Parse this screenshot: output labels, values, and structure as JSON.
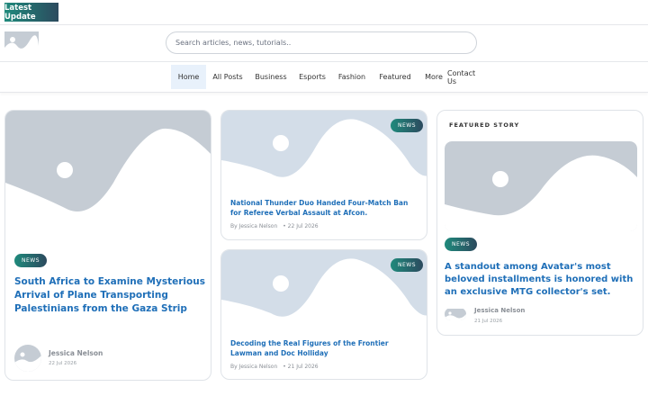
{
  "topbar": {
    "latest_label": "Latest Update"
  },
  "header": {
    "search_placeholder": "Search articles, news, tutorials.."
  },
  "nav": {
    "items": [
      "Home",
      "All Posts",
      "Business",
      "Esports",
      "Fashion",
      "Featured",
      "More",
      "Contact Us"
    ],
    "active": "Home"
  },
  "cards": [
    {
      "badge": "NEWS",
      "title": "South Africa to Examine Mysterious Arrival of Plane Transporting Palestinians from the Gaza Strip",
      "author": "Jessica Nelson",
      "date": "22 Jul 2026"
    },
    {
      "badge": "NEWS",
      "title": "National Thunder Duo Handed Four-Match Ban for Referee Verbal Assault at Afcon.",
      "byline": "By Jessica Nelson",
      "date": "• 22 Jul 2026"
    },
    {
      "badge": "NEWS",
      "title": "Decoding the Real Figures of the Frontier Lawman and Doc Holliday",
      "byline": "By Jessica Nelson",
      "date": "• 21 Jul 2026"
    }
  ],
  "featured": {
    "label": "FEATURED STORY",
    "badge": "NEWS",
    "title": "A standout among Avatar's most beloved installments is honored with an exclusive MTG collector's set.",
    "author": "Jessica Nelson",
    "date": "21 Jul 2026"
  },
  "colors": {
    "accent_start": "#1f8a7c",
    "accent_end": "#2c4a5e",
    "link": "#1f6fb8",
    "placeholder_bg": "#c5ccd4",
    "placeholder_bg_light": "#d3dde8"
  }
}
